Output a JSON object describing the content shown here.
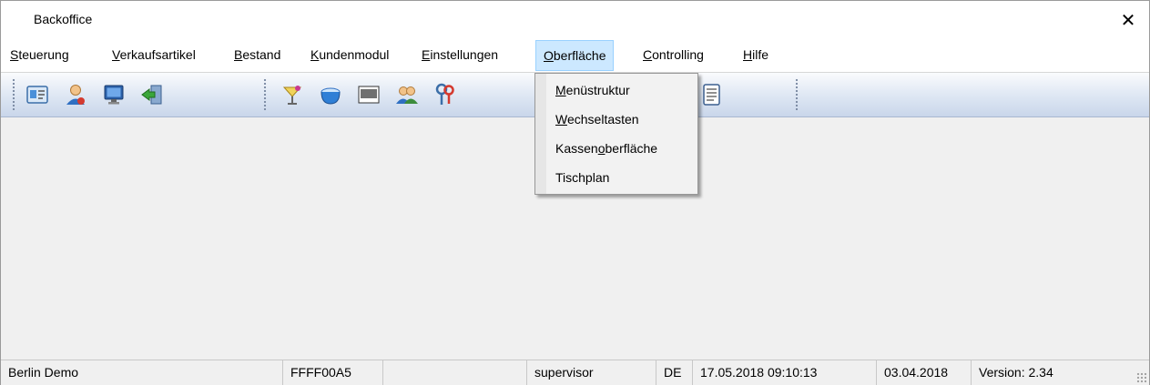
{
  "window": {
    "title": "Backoffice",
    "close_glyph": "✕"
  },
  "menubar": {
    "items": [
      {
        "label": "Steuerung",
        "hotkey": "S",
        "rest": "teuerung"
      },
      {
        "label": "Verkaufsartikel",
        "hotkey": "V",
        "rest": "erkaufsartikel"
      },
      {
        "label": "Bestand",
        "hotkey": "B",
        "rest": "estand"
      },
      {
        "label": "Kundenmodul",
        "hotkey": "K",
        "rest": "undenmodul"
      },
      {
        "label": "Einstellungen",
        "hotkey": "E",
        "rest": "instellungen"
      },
      {
        "label": "Oberfläche",
        "hotkey": "O",
        "rest": "berfläche"
      },
      {
        "label": "Controlling",
        "hotkey": "C",
        "rest": "ontrolling"
      },
      {
        "label": "Hilfe",
        "hotkey": "H",
        "rest": "ilfe"
      }
    ],
    "active_item": "Oberfläche"
  },
  "toolbar": {
    "icons": [
      "id-card-icon",
      "user-icon",
      "monitor-icon",
      "exit-icon",
      "cocktail-icon",
      "bowl-icon",
      "barcode-icon",
      "users-icon",
      "keys-icon",
      "document-icon"
    ]
  },
  "dropdown": {
    "items": [
      {
        "label": "Menüstruktur",
        "pre": "",
        "hotkey": "M",
        "post": "enüstruktur"
      },
      {
        "label": "Wechseltasten",
        "pre": "",
        "hotkey": "W",
        "post": "echseltasten"
      },
      {
        "label": "Kassenoberfläche",
        "pre": "Kassen",
        "hotkey": "o",
        "post": "berfläche"
      },
      {
        "label": "Tischplan",
        "pre": "Tischplan",
        "hotkey": "",
        "post": ""
      }
    ]
  },
  "statusbar": {
    "location": "Berlin Demo",
    "code": "FFFF00A5",
    "empty": "",
    "user": "supervisor",
    "language": "DE",
    "datetime": "17.05.2018 09:10:13",
    "date": "03.04.2018",
    "version": "Version: 2.34"
  },
  "colors": {
    "menu_active_bg": "#cce8ff",
    "menu_active_border": "#99d1ff",
    "toolbar_top": "#fafbfd",
    "toolbar_bottom": "#c9d6ea"
  }
}
